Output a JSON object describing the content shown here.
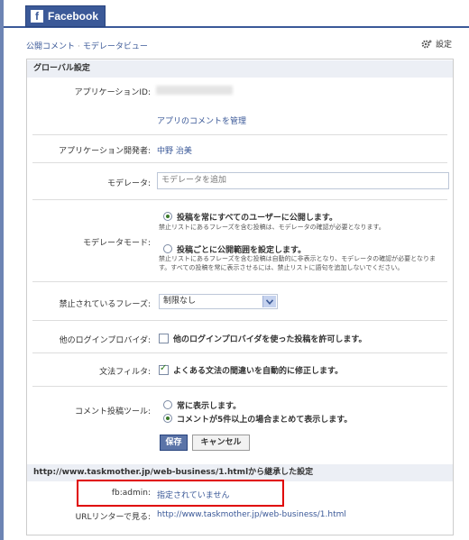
{
  "brand": {
    "logo_letter": "f",
    "tab_label": "Facebook"
  },
  "header": {
    "breadcrumb_1": "公開コメント",
    "separator": "·",
    "breadcrumb_2": "モデレータビュー",
    "settings_label": "設定"
  },
  "global": {
    "section_title": "グローバル設定",
    "app_id_label": "アプリケーションID:",
    "manage_comments_link": "アプリのコメントを管理",
    "developer_label": "アプリケーション開発者:",
    "developer_name": "中野 治美",
    "moderator_label": "モデレータ:",
    "moderator_placeholder": "モデレータを追加",
    "mode_label": "モデレータモード:",
    "mode_option_1": "投稿を常にすべてのユーザーに公開します。",
    "mode_option_1_note": "禁止リストにあるフレーズを含む投稿は、モデレータの確認が必要となります。",
    "mode_option_2": "投稿ごとに公開範囲を設定します。",
    "mode_option_2_note_1": "禁止リストにあるフレーズを含む投稿は自動的に非表示となり、モデレータの確認が必要となりま",
    "mode_option_2_note_2": "す。すべての投稿を常に表示させるには、禁止リストに語句を追加しないでください。",
    "banned_label": "禁止されているフレーズ:",
    "banned_value": "制限なし",
    "other_login_label": "他のログインプロバイダ:",
    "other_login_option": "他のログインプロバイダを使った投稿を許可します。",
    "grammar_label": "文法フィルタ:",
    "grammar_option": "よくある文法の間違いを自動的に修正します。",
    "tool_label": "コメント投稿ツール:",
    "tool_option_1": "常に表示します。",
    "tool_option_2": "コメントが5件以上の場合まとめて表示します。",
    "save_button": "保存",
    "cancel_button": "キャンセル"
  },
  "inherited": {
    "section_title": "http://www.taskmother.jp/web-business/1.htmlから継承した設定",
    "fb_admin_label": "fb:admin:",
    "fb_admin_value": "指定されていません",
    "url_linter_label": "URLリンターで見る:",
    "url_linter_link": "http://www.taskmother.jp/web-business/1.html"
  },
  "colors": {
    "brand": "#3b5998",
    "highlight_border": "#e00000"
  }
}
